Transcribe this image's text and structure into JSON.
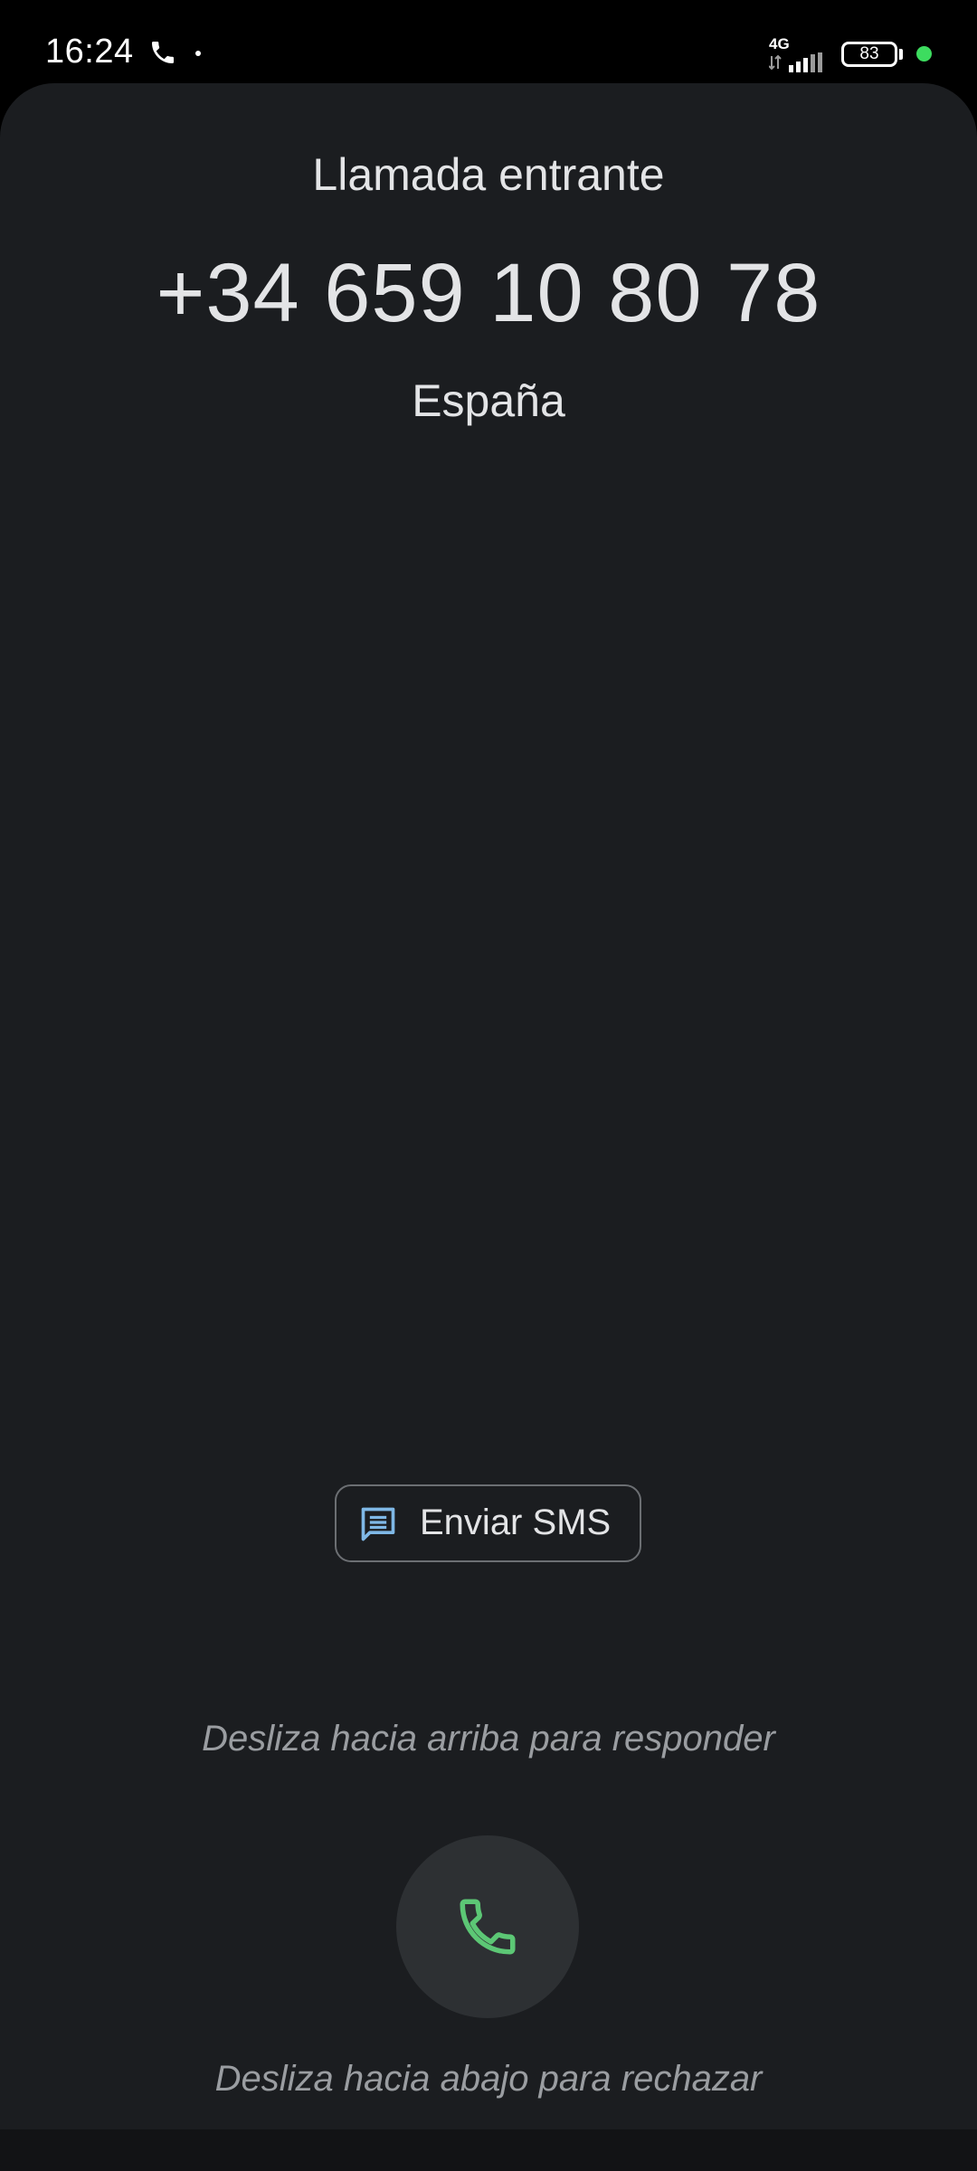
{
  "status_bar": {
    "time": "16:24",
    "network": "4G",
    "battery": "83",
    "icons": [
      "phone-icon",
      "notification-dot-icon",
      "signal-icon",
      "battery-icon",
      "privacy-indicator-icon"
    ]
  },
  "call": {
    "status": "Llamada entrante",
    "number": "+34 659 10 80 78",
    "location": "España"
  },
  "actions": {
    "sms_label": "Enviar SMS",
    "sms_icon": "message-icon",
    "answer_hint": "Desliza hacia arriba para responder",
    "answer_icon": "phone-answer-icon",
    "reject_hint": "Desliza hacia abajo para rechazar"
  },
  "colors": {
    "panel_background": "#1b1d20",
    "answer_icon": "#5cc775",
    "sms_icon": "#7fb8e6",
    "privacy_indicator": "#3ddc5f"
  }
}
